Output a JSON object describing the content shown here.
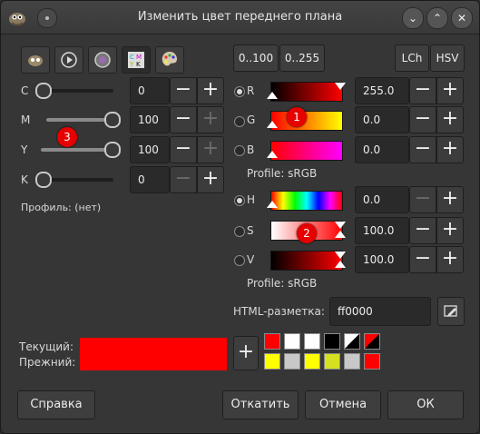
{
  "window": {
    "title": "Изменить цвет переднего плана",
    "controls": {
      "minimize": "⌄",
      "maximize": "⌃",
      "close": "✕"
    }
  },
  "selectors": {
    "tabs": [
      "scales-icon",
      "watercolor-icon",
      "wheel-icon",
      "cmyk-icon",
      "palette-icon"
    ],
    "active_tab": "cmyk-icon",
    "cmyk_glyph": "CMYK"
  },
  "range_buttons": {
    "r0_100": "0..100",
    "r0_255": "0..255"
  },
  "mode_buttons": {
    "lch": "LCh",
    "hsv": "HSV"
  },
  "cmyk": {
    "c": {
      "label": "C",
      "value": "0",
      "level": 0
    },
    "m": {
      "label": "M",
      "value": "100",
      "level": 100
    },
    "y": {
      "label": "Y",
      "value": "100",
      "level": 100
    },
    "k": {
      "label": "K",
      "value": "0",
      "level": 0
    },
    "profile": "Профиль: (нет)"
  },
  "rgb": {
    "r": {
      "label": "R",
      "value": "255.0"
    },
    "g": {
      "label": "G",
      "value": "0.0"
    },
    "b": {
      "label": "B",
      "value": "0.0"
    },
    "profile": "Profile: sRGB"
  },
  "hsv": {
    "h": {
      "label": "H",
      "value": "0.0"
    },
    "s": {
      "label": "S",
      "value": "100.0"
    },
    "v": {
      "label": "V",
      "value": "100.0"
    },
    "profile": "Profile: sRGB"
  },
  "html_notation": {
    "label": "HTML-разметка:",
    "value": "ff0000"
  },
  "preview": {
    "current_label": "Текущий:",
    "previous_label": "Прежний:",
    "current_color": "#ff0000",
    "previous_color": "#ff0000"
  },
  "add_button": "+",
  "history": {
    "row1": [
      "#ff0000",
      "#ffffff",
      "#ffffff",
      "#000000",
      "#ffffff",
      "#ff0000"
    ],
    "row2": [
      "#ffff00",
      "#c8c8c8",
      "#ffff00",
      "#d4e020",
      "#c8c8c8",
      "#ff0000"
    ]
  },
  "annotations": [
    "1",
    "2",
    "3"
  ],
  "footer": {
    "help": "Справка",
    "reset": "Откатить",
    "cancel": "Отмена",
    "ok": "ОК"
  }
}
